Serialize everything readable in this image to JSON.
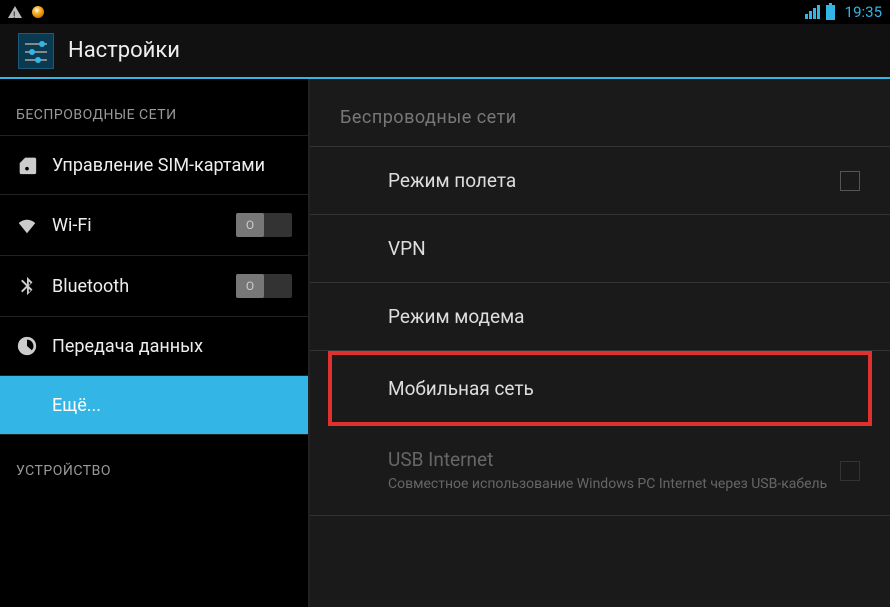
{
  "status_bar": {
    "time": "19:35"
  },
  "header": {
    "title": "Настройки"
  },
  "sidebar": {
    "section_wireless": "БЕСПРОВОДНЫЕ СЕТИ",
    "section_device": "УСТРОЙСТВО",
    "items": {
      "sim": "Управление SIM-картами",
      "wifi": "Wi-Fi",
      "bluetooth": "Bluetooth",
      "data_usage": "Передача данных",
      "more": "Ещё..."
    }
  },
  "content": {
    "section_title": "Беспроводные сети",
    "items": {
      "airplane": "Режим полета",
      "vpn": "VPN",
      "tethering": "Режим модема",
      "mobile_network": "Мобильная сеть",
      "usb_internet": {
        "title": "USB Internet",
        "subtitle": "Совместное использование Windows PC Internet через USB-кабель"
      }
    }
  }
}
